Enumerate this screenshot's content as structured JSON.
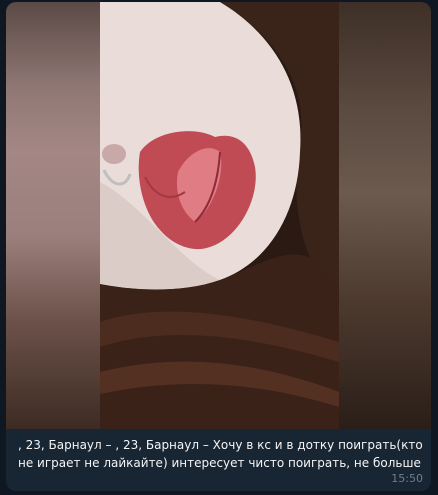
{
  "message": {
    "caption": ", 23, Барнаул – , 23, Барнаул – Хочу в кс и в дотку поиграть(кто не играет не лайкайте) интересует чисто поиграть, не больше",
    "time": "15:50"
  },
  "colors": {
    "chat_background": "#0f1722",
    "bubble": "#182533",
    "text": "#f5f5f5",
    "time": "#6d7f8f"
  }
}
